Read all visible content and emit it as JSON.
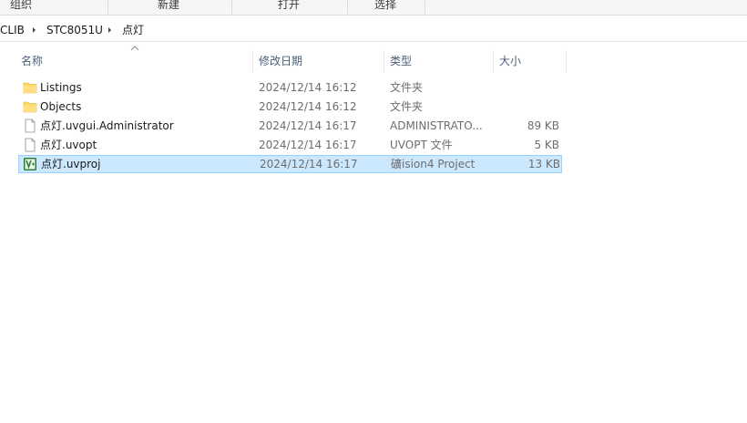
{
  "ribbon": {
    "groups": [
      "组织",
      "新建",
      "打开",
      "选择"
    ]
  },
  "breadcrumb": {
    "items": [
      "CLIB",
      "STC8051U",
      "点灯"
    ]
  },
  "columns": {
    "name": "名称",
    "date": "修改日期",
    "type": "类型",
    "size": "大小"
  },
  "files": [
    {
      "name": "Listings",
      "date": "2024/12/14 16:12",
      "type": "文件夹",
      "size": "",
      "icon": "folder-icon"
    },
    {
      "name": "Objects",
      "date": "2024/12/14 16:12",
      "type": "文件夹",
      "size": "",
      "icon": "folder-icon"
    },
    {
      "name": "点灯.uvgui.Administrator",
      "date": "2024/12/14 16:17",
      "type": "ADMINISTRATO...",
      "size": "89 KB",
      "icon": "file-icon"
    },
    {
      "name": "点灯.uvopt",
      "date": "2024/12/14 16:17",
      "type": "UVOPT 文件",
      "size": "5 KB",
      "icon": "file-icon"
    },
    {
      "name": "点灯.uvproj",
      "date": "2024/12/14 16:17",
      "type": "礦ision4 Project",
      "size": "13 KB",
      "icon": "keil-project-icon",
      "selected": true
    }
  ],
  "colors": {
    "selection_bg": "#cce8ff",
    "selection_border": "#99d1ff",
    "folder": "#ffd766",
    "header_text": "#4c607a"
  }
}
